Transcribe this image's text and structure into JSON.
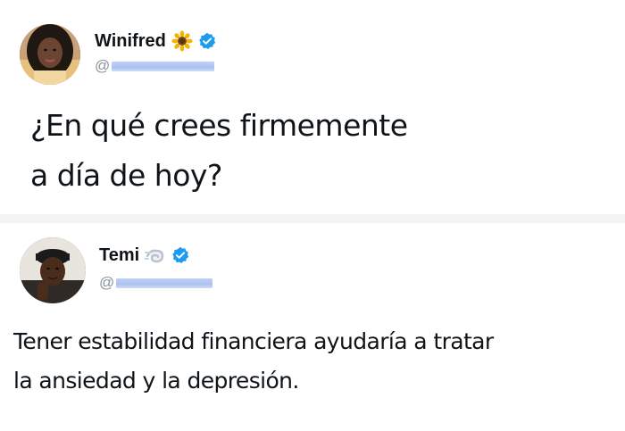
{
  "tweet_top": {
    "author": {
      "name": "Winifred",
      "name_emoji": "sunflower-icon",
      "verified_icon": "verified-badge-icon",
      "handle_prefix": "@",
      "avatar": "profile-photo-woman"
    },
    "text_line_1": "¿En qué crees firmemente",
    "text_line_2": "a día de hoy?"
  },
  "tweet_bottom": {
    "author": {
      "name": "Temi",
      "name_emoji": "dash-icon",
      "verified_icon": "verified-badge-icon",
      "handle_prefix": "@",
      "avatar": "profile-photo-man"
    },
    "text_line_1": "Tener estabilidad financiera ayudaría a tratar",
    "text_line_2": "la ansiedad y la depresión."
  },
  "colors": {
    "verified_blue": "#1d9bf0",
    "text": "#0f1419",
    "handle_gray": "#8a949c",
    "divider": "#f2f3f5"
  }
}
